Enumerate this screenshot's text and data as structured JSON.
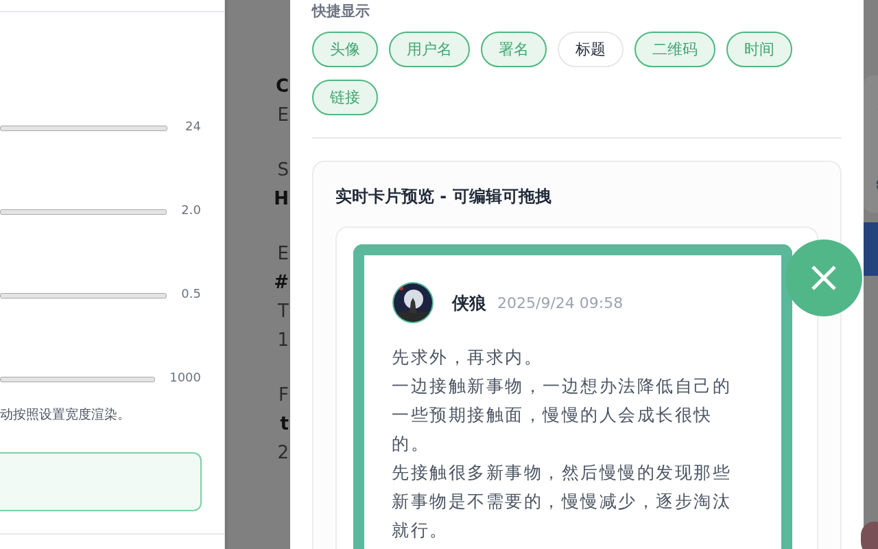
{
  "settings_panel": {
    "sliders": [
      {
        "reading": "24"
      },
      {
        "reading": "2.0"
      },
      {
        "reading": "0.5"
      },
      {
        "reading": "1000"
      }
    ],
    "hint": "动按照设置宽度渲染。"
  },
  "background_groups": [
    [
      {
        "text": "C",
        "kind": "bold"
      },
      {
        "text": "E",
        "kind": "normal"
      }
    ],
    [
      {
        "text": "S",
        "kind": "normal"
      },
      {
        "text": "H",
        "kind": "bold"
      }
    ],
    [
      {
        "text": "E",
        "kind": "normal"
      },
      {
        "text": "#",
        "kind": "bold"
      },
      {
        "text": "T",
        "kind": "normal"
      },
      {
        "text": "1",
        "kind": "normal"
      }
    ],
    [
      {
        "text": "F",
        "kind": "normal"
      },
      {
        "text": "t",
        "kind": "bold"
      },
      {
        "text": "2",
        "kind": "normal"
      }
    ]
  ],
  "dialog": {
    "section_label": "快捷显示",
    "chips": [
      {
        "label": "头像",
        "selected": true
      },
      {
        "label": "用户名",
        "selected": true
      },
      {
        "label": "署名",
        "selected": true
      },
      {
        "label": "标题",
        "selected": false
      },
      {
        "label": "二维码",
        "selected": true
      },
      {
        "label": "时间",
        "selected": true
      },
      {
        "label": "链接",
        "selected": true
      }
    ],
    "preview": {
      "title": "实时卡片预览 - 可编辑可拖拽",
      "card": {
        "author": "侠狼",
        "time": "2025/9/24 09:58",
        "paragraphs": [
          "先求外，再求内。",
          "一边接触新事物，一边想办法降低自己的一些预期接触面，慢慢的人会成长很快的。",
          "先接触很多新事物，然后慢慢的发现那些新事物是不需要的，慢慢减少，逐步淘汰就行。"
        ]
      }
    }
  }
}
